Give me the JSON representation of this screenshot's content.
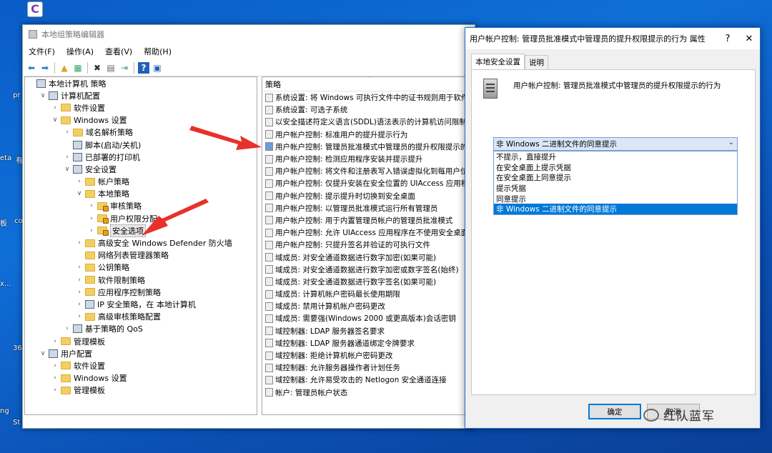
{
  "desktop": {
    "labels": [
      "pr",
      "eta",
      "有",
      "板",
      "co",
      "x...",
      "36",
      "ng",
      "St"
    ]
  },
  "mmc": {
    "title": "本地组策略编辑器",
    "menu": [
      "文件(F)",
      "操作(A)",
      "查看(V)",
      "帮助(H)"
    ],
    "tree": [
      {
        "indent": 0,
        "tw": "",
        "icon": "node",
        "label": "本地计算机 策略"
      },
      {
        "indent": 1,
        "tw": "∨",
        "icon": "node",
        "label": "计算机配置"
      },
      {
        "indent": 2,
        "tw": "›",
        "icon": "folder",
        "label": "软件设置"
      },
      {
        "indent": 2,
        "tw": "∨",
        "icon": "folder",
        "label": "Windows 设置"
      },
      {
        "indent": 3,
        "tw": "›",
        "icon": "folder",
        "label": "域名解析策略"
      },
      {
        "indent": 3,
        "tw": "",
        "icon": "node",
        "label": "脚本(启动/关机)"
      },
      {
        "indent": 3,
        "tw": "›",
        "icon": "node",
        "label": "已部署的打印机"
      },
      {
        "indent": 3,
        "tw": "∨",
        "icon": "node",
        "label": "安全设置"
      },
      {
        "indent": 4,
        "tw": "›",
        "icon": "folder",
        "label": "帐户策略"
      },
      {
        "indent": 4,
        "tw": "∨",
        "icon": "folder",
        "label": "本地策略"
      },
      {
        "indent": 5,
        "tw": "›",
        "icon": "folder-lock",
        "label": "审核策略"
      },
      {
        "indent": 5,
        "tw": "›",
        "icon": "folder-lock",
        "label": "用户权限分配"
      },
      {
        "indent": 5,
        "tw": "›",
        "icon": "folder-lock",
        "label": "安全选项",
        "selected": true
      },
      {
        "indent": 4,
        "tw": "›",
        "icon": "folder",
        "label": "高级安全 Windows Defender 防火墙"
      },
      {
        "indent": 4,
        "tw": "",
        "icon": "folder",
        "label": "网络列表管理器策略"
      },
      {
        "indent": 4,
        "tw": "›",
        "icon": "folder",
        "label": "公钥策略"
      },
      {
        "indent": 4,
        "tw": "›",
        "icon": "folder",
        "label": "软件限制策略"
      },
      {
        "indent": 4,
        "tw": "›",
        "icon": "folder",
        "label": "应用程序控制策略"
      },
      {
        "indent": 4,
        "tw": "›",
        "icon": "node",
        "label": "IP 安全策略，在 本地计算机"
      },
      {
        "indent": 4,
        "tw": "›",
        "icon": "folder",
        "label": "高级审核策略配置"
      },
      {
        "indent": 3,
        "tw": "›",
        "icon": "node",
        "label": "基于策略的 QoS"
      },
      {
        "indent": 2,
        "tw": "›",
        "icon": "folder",
        "label": "管理模板"
      },
      {
        "indent": 1,
        "tw": "∨",
        "icon": "node",
        "label": "用户配置"
      },
      {
        "indent": 2,
        "tw": "›",
        "icon": "folder",
        "label": "软件设置"
      },
      {
        "indent": 2,
        "tw": "›",
        "icon": "folder",
        "label": "Windows 设置"
      },
      {
        "indent": 2,
        "tw": "›",
        "icon": "folder",
        "label": "管理模板"
      }
    ],
    "list_header": "策略",
    "policies": [
      {
        "label": "系统设置: 将 Windows 可执行文件中的证书规则用于软件..."
      },
      {
        "label": "系统设置: 可选子系统"
      },
      {
        "label": "以安全描述符定义语言(SDDL)语法表示的计算机访问限制"
      },
      {
        "label": "用户帐户控制: 标准用户的提升提示行为"
      },
      {
        "label": "用户帐户控制: 管理员批准模式中管理员的提升权限提示的...",
        "selected": true
      },
      {
        "label": "用户帐户控制: 检测应用程序安装并提示提升"
      },
      {
        "label": "用户帐户控制: 将文件和注册表写入错误虚拟化到每用户位置"
      },
      {
        "label": "用户帐户控制: 仅提升安装在安全位置的 UIAccess 应用程序"
      },
      {
        "label": "用户帐户控制: 提示提升时切换到安全桌面"
      },
      {
        "label": "用户帐户控制: 以管理员批准模式运行所有管理员"
      },
      {
        "label": "用户帐户控制: 用于内置管理员帐户的管理员批准模式"
      },
      {
        "label": "用户帐户控制: 允许 UIAccess 应用程序在不使用安全桌面..."
      },
      {
        "label": "用户帐户控制: 只提升签名并验证的可执行文件"
      },
      {
        "label": "域成员: 对安全通道数据进行数字加密(如果可能)"
      },
      {
        "label": "域成员: 对安全通道数据进行数字加密或数字签名(始终)"
      },
      {
        "label": "域成员: 对安全通道数据进行数字签名(如果可能)"
      },
      {
        "label": "域成员: 计算机帐户密码最长使用期限"
      },
      {
        "label": "域成员: 禁用计算机帐户密码更改"
      },
      {
        "label": "域成员: 需要强(Windows 2000 或更高版本)会话密钥"
      },
      {
        "label": "域控制器: LDAP 服务器签名要求"
      },
      {
        "label": "域控制器: LDAP 服务器通道绑定令牌要求"
      },
      {
        "label": "域控制器: 拒绝计算机帐户密码更改"
      },
      {
        "label": "域控制器: 允许服务器操作者计划任务"
      },
      {
        "label": "域控制器: 允许易受攻击的 Netlogon 安全通道连接"
      },
      {
        "label": "帐户: 管理员帐户状态"
      }
    ]
  },
  "dialog": {
    "title": "用户帐户控制: 管理员批准模式中管理员的提升权限提示的行为 属性",
    "help": "?",
    "close": "✕",
    "tabs": [
      "本地安全设置",
      "说明"
    ],
    "policy_name": "用户帐户控制: 管理员批准模式中管理员的提升权限提示的行为",
    "combo_value": "非 Windows 二进制文件的同意提示",
    "options": [
      "不提示，直接提升",
      "在安全桌面上提示凭据",
      "在安全桌面上同意提示",
      "提示凭据",
      "同意提示",
      "非 Windows 二进制文件的同意提示"
    ],
    "selected_option": 5,
    "ok": "确定",
    "cancel": "取消"
  },
  "watermark": "红队蓝军",
  "colors": {
    "accent": "#0078d7",
    "arrow": "#e8312b",
    "desktop": "#0b5cc4"
  }
}
